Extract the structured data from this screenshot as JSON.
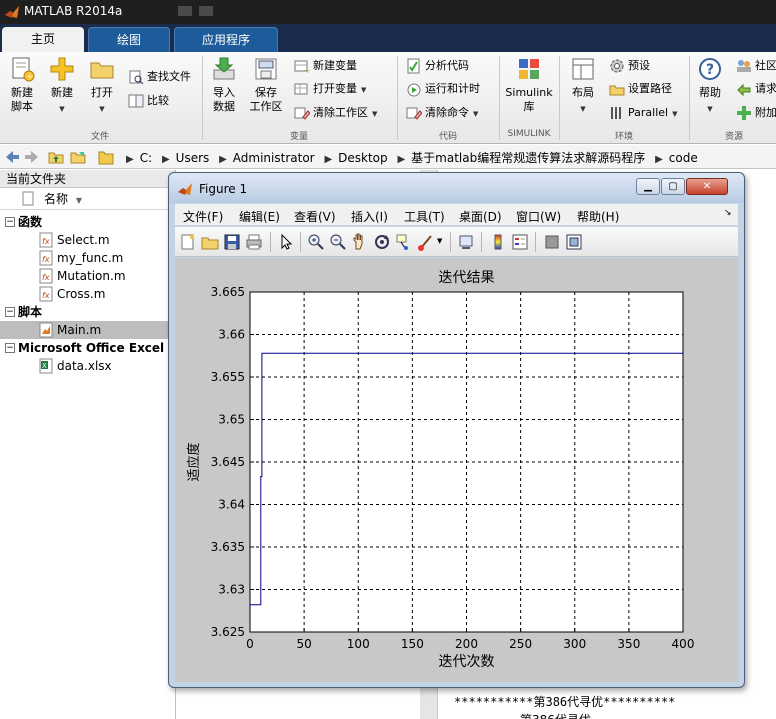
{
  "app": {
    "title": "MATLAB R2014a"
  },
  "tabs": [
    {
      "label": "主页",
      "active": true
    },
    {
      "label": "绘图",
      "active": false
    },
    {
      "label": "应用程序",
      "active": false
    }
  ],
  "ribbon": {
    "file": {
      "new_script": "新建\n脚本",
      "new": "新建",
      "open": "打开",
      "find_files": "查找文件",
      "compare": "比较",
      "group_label": "文件"
    },
    "variable": {
      "import": "导入\n数据",
      "save_ws": "保存\n工作区",
      "new_var": "新建变量",
      "open_var": "打开变量",
      "clear_ws": "清除工作区",
      "group_label": "变量"
    },
    "code": {
      "analyze": "分析代码",
      "run_time": "运行和计时",
      "clear_cmd": "清除命令",
      "group_label": "代码"
    },
    "simulink": {
      "label": "Simulink\n库",
      "group_label": "SIMULINK"
    },
    "env": {
      "layout": "布局",
      "prefs": "预设",
      "set_path": "设置路径",
      "parallel": "Parallel",
      "group_label": "环境"
    },
    "resources": {
      "help": "帮助",
      "community": "社区",
      "request": "请求",
      "addons": "附加",
      "group_label": "资源"
    }
  },
  "address": {
    "crumbs": [
      "C:",
      "Users",
      "Administrator",
      "Desktop",
      "基于matlab编程常规遗传算法求解源码程序",
      "code"
    ]
  },
  "file_browser": {
    "title": "当前文件夹",
    "column_name": "名称",
    "groups": [
      {
        "label": "函数",
        "files": [
          "Select.m",
          "my_func.m",
          "Mutation.m",
          "Cross.m"
        ]
      },
      {
        "label": "脚本",
        "files": [
          "Main.m"
        ]
      },
      {
        "label": "Microsoft Office Excel 工",
        "files": [
          "data.xlsx"
        ]
      }
    ],
    "selected_file": "Main.m"
  },
  "command_window": {
    "line1": "***********第386代寻优**********",
    "line2": "第386代寻优"
  },
  "figure": {
    "title": "Figure 1",
    "menus": [
      "文件(F)",
      "编辑(E)",
      "查看(V)",
      "插入(I)",
      "工具(T)",
      "桌面(D)",
      "窗口(W)",
      "帮助(H)"
    ]
  },
  "chart_data": {
    "type": "line",
    "title": "迭代结果",
    "xlabel": "迭代次数",
    "ylabel": "适应度",
    "xlim": [
      0,
      400
    ],
    "ylim": [
      3.625,
      3.665
    ],
    "xticks": [
      0,
      50,
      100,
      150,
      200,
      250,
      300,
      350,
      400
    ],
    "yticks": [
      3.625,
      3.63,
      3.635,
      3.64,
      3.645,
      3.65,
      3.655,
      3.66,
      3.665
    ],
    "ytick_labels": [
      "3.625",
      "3.63",
      "3.635",
      "3.64",
      "3.645",
      "3.65",
      "3.655",
      "3.66",
      "3.665"
    ],
    "grid": true,
    "line_color": "#00008b",
    "series": [
      {
        "x": [
          0,
          10,
          10,
          11,
          11,
          400
        ],
        "y": [
          3.6282,
          3.6282,
          3.6433,
          3.6433,
          3.6578,
          3.6578
        ]
      }
    ]
  }
}
